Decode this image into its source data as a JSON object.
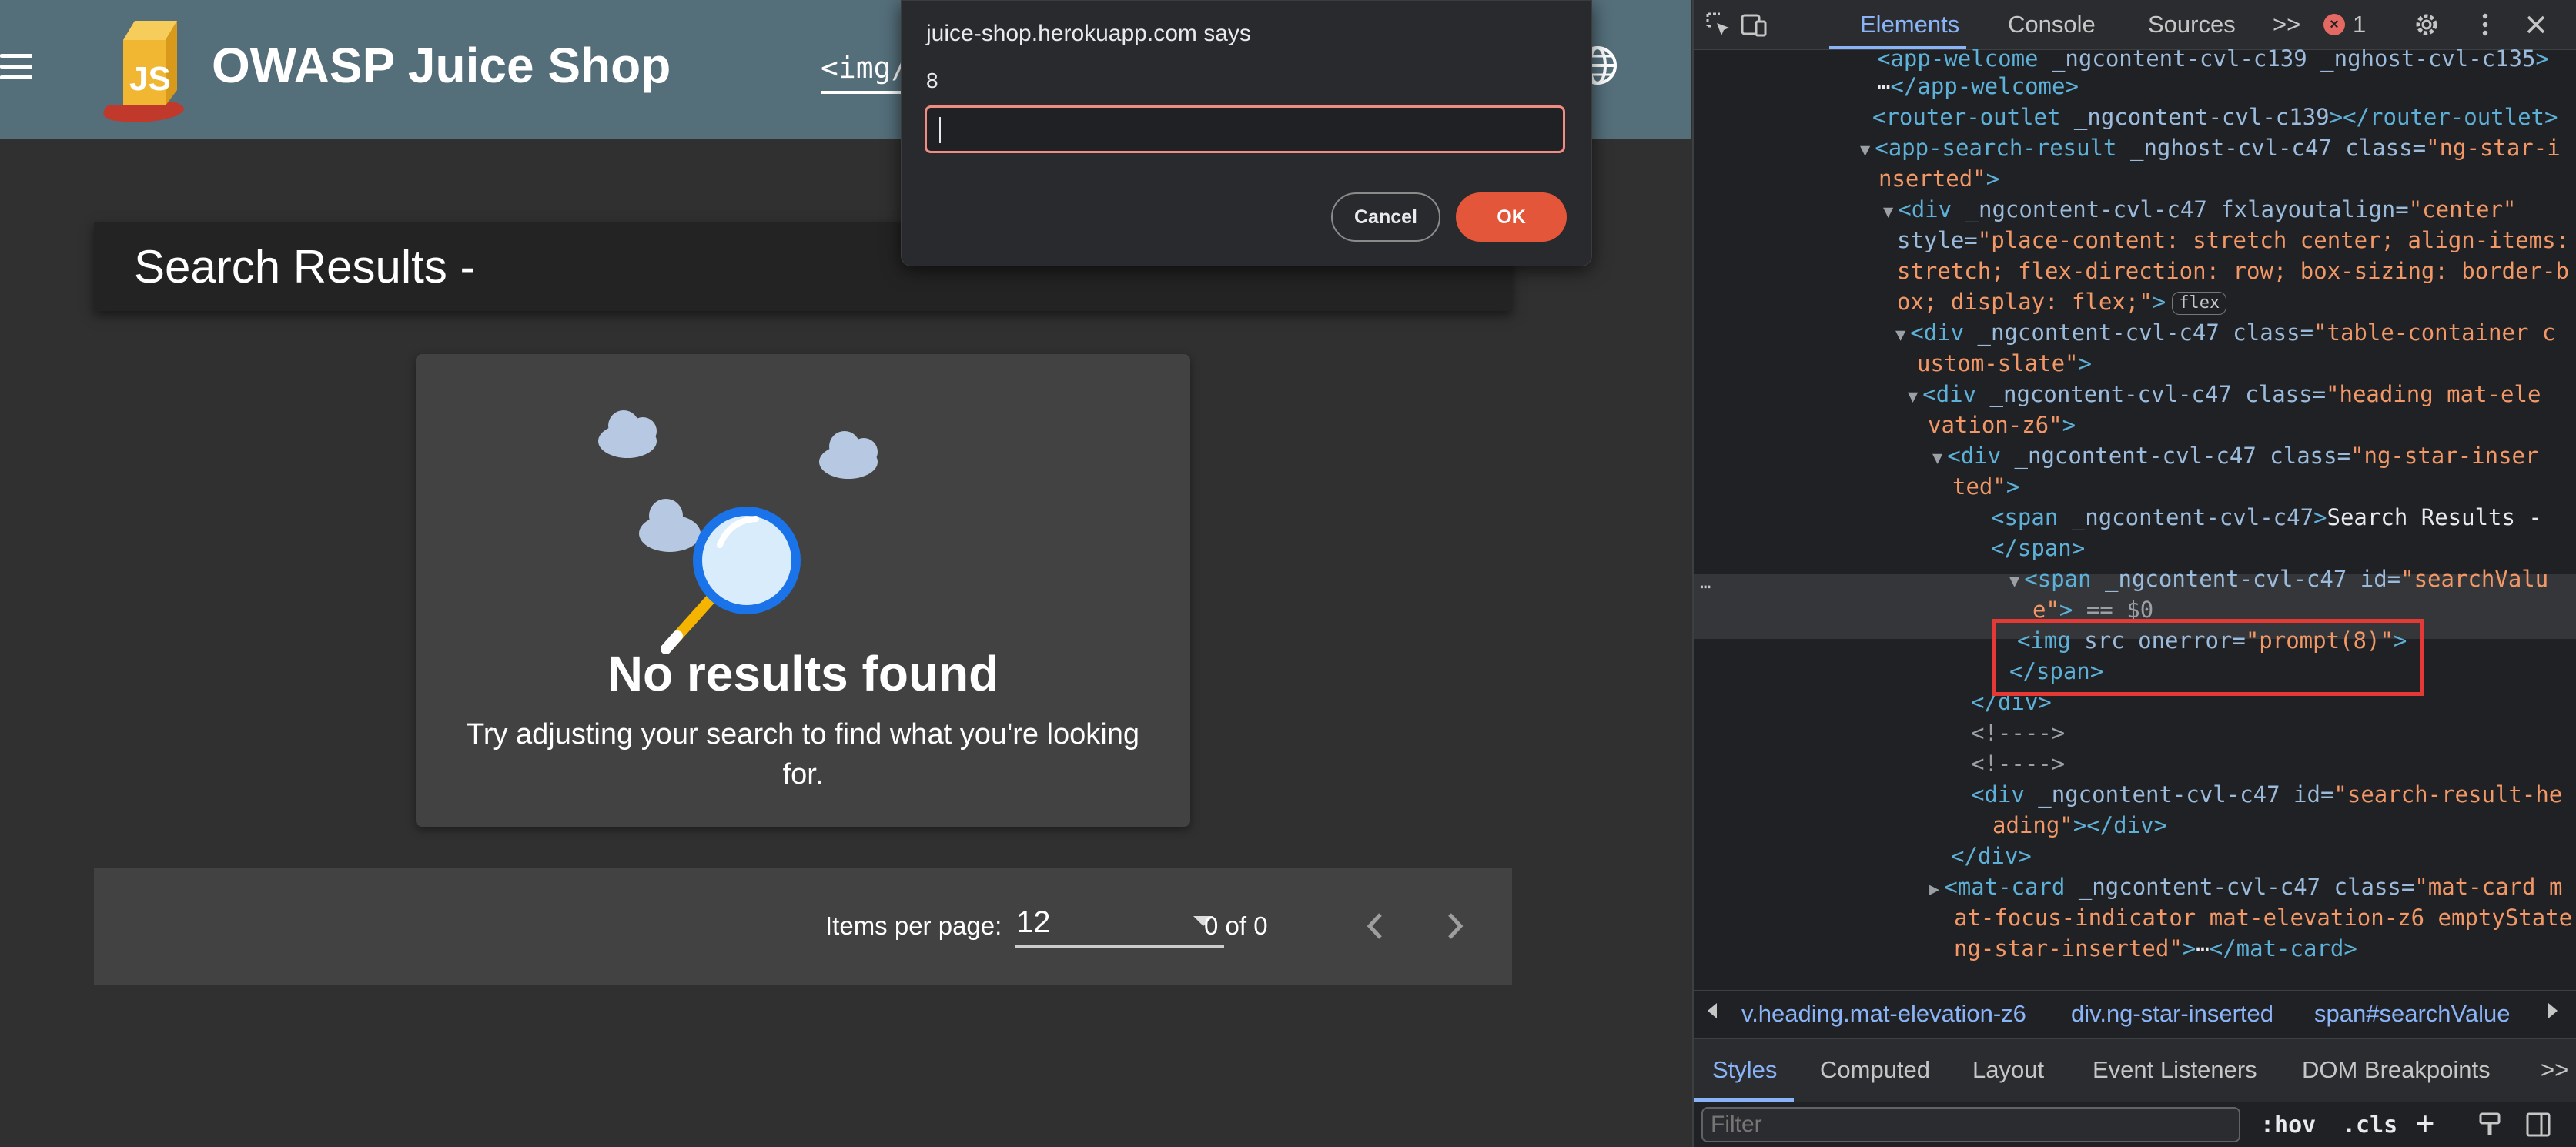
{
  "app": {
    "title": "OWASP Juice Shop",
    "search_value": "<img/s",
    "results_heading": "Search Results -",
    "empty_state": {
      "title": "No results found",
      "text": "Try adjusting your search to find what you're looking for."
    },
    "paginator": {
      "items_per_page_label": "Items per page:",
      "page_size": "12",
      "range": "0 of 0"
    }
  },
  "dialog": {
    "title": "juice-shop.herokuapp.com says",
    "message": "8",
    "input_value": "",
    "cancel_label": "Cancel",
    "ok_label": "OK"
  },
  "devtools": {
    "tabs": [
      "Elements",
      "Console",
      "Sources",
      ">>"
    ],
    "error_count": "1",
    "dom_lines": [
      {
        "parts": [
          [
            "tag",
            "<app-welcome"
          ],
          [
            "attr",
            " _ngcontent-cvl-c139 _nghost-cvl-c135"
          ],
          [
            "tag",
            ">"
          ]
        ]
      },
      {
        "parts": [
          [
            "txt",
            "⋯"
          ],
          [
            "tag",
            "</app-welcome>"
          ]
        ]
      },
      {
        "parts": [
          [
            "tag",
            "<router-outlet"
          ],
          [
            "attr",
            " _ngcontent-cvl-c139"
          ],
          [
            "tag",
            "></router-outlet>"
          ]
        ]
      },
      {
        "parts": [
          [
            "arrow",
            "▼"
          ],
          [
            "tag",
            "<app-search-result"
          ],
          [
            "attr",
            " _nghost-cvl-c47 class="
          ],
          [
            "val",
            "\"ng-star-i"
          ]
        ]
      },
      {
        "parts": [
          [
            "val",
            "nserted\""
          ],
          [
            "tag",
            ">"
          ]
        ]
      },
      {
        "parts": [
          [
            "arrow",
            "▼"
          ],
          [
            "tag",
            "<div"
          ],
          [
            "attr",
            " _ngcontent-cvl-c47 fxlayoutalign="
          ],
          [
            "val",
            "\"center\""
          ]
        ]
      },
      {
        "parts": [
          [
            "attr",
            "style="
          ],
          [
            "val",
            "\"place-content: stretch center; align-items:"
          ]
        ]
      },
      {
        "parts": [
          [
            "val",
            "stretch; flex-direction: row; box-sizing: border-b"
          ]
        ]
      },
      {
        "parts": [
          [
            "val",
            "ox; display: flex;\""
          ],
          [
            "tag",
            ">"
          ],
          [
            "pill",
            "flex"
          ]
        ]
      },
      {
        "parts": [
          [
            "arrow",
            "▼"
          ],
          [
            "tag",
            "<div"
          ],
          [
            "attr",
            " _ngcontent-cvl-c47 class="
          ],
          [
            "val",
            "\"table-container c"
          ]
        ]
      },
      {
        "parts": [
          [
            "val",
            "ustom-slate\""
          ],
          [
            "tag",
            ">"
          ]
        ]
      },
      {
        "parts": [
          [
            "arrow",
            "▼"
          ],
          [
            "tag",
            "<div"
          ],
          [
            "attr",
            " _ngcontent-cvl-c47 class="
          ],
          [
            "val",
            "\"heading mat-ele"
          ]
        ]
      },
      {
        "parts": [
          [
            "val",
            "vation-z6\""
          ],
          [
            "tag",
            ">"
          ]
        ]
      },
      {
        "parts": [
          [
            "arrow",
            "▼"
          ],
          [
            "tag",
            "<div"
          ],
          [
            "attr",
            " _ngcontent-cvl-c47 class="
          ],
          [
            "val",
            "\"ng-star-inser"
          ]
        ]
      },
      {
        "parts": [
          [
            "val",
            "ted\""
          ],
          [
            "tag",
            ">"
          ]
        ]
      },
      {
        "parts": [
          [
            "tag",
            "<span"
          ],
          [
            "attr",
            " _ngcontent-cvl-c47"
          ],
          [
            "tag",
            ">"
          ],
          [
            "txt",
            "Search Results -"
          ]
        ]
      },
      {
        "parts": [
          [
            "tag",
            "</span>"
          ]
        ]
      },
      {
        "parts": [
          [
            "arrow",
            "▼"
          ],
          [
            "tag",
            "<span"
          ],
          [
            "attr",
            " _ngcontent-cvl-c47 id="
          ],
          [
            "val",
            "\"searchValu"
          ]
        ]
      },
      {
        "parts": [
          [
            "val",
            "e\""
          ],
          [
            "tag",
            ">"
          ],
          [
            "cmt",
            " == $0"
          ]
        ]
      },
      {
        "parts": [
          [
            "tag",
            "<img"
          ],
          [
            "attr",
            " src onerror="
          ],
          [
            "val",
            "\"prompt(8)\""
          ],
          [
            "tag",
            ">"
          ]
        ]
      },
      {
        "parts": [
          [
            "tag",
            "</span>"
          ]
        ]
      },
      {
        "parts": [
          [
            "tag",
            "</div>"
          ]
        ]
      },
      {
        "parts": [
          [
            "cmt",
            "<!---->"
          ]
        ]
      },
      {
        "parts": [
          [
            "cmt",
            "<!---->"
          ]
        ]
      },
      {
        "parts": [
          [
            "tag",
            "<div"
          ],
          [
            "attr",
            " _ngcontent-cvl-c47 id="
          ],
          [
            "val",
            "\"search-result-he"
          ]
        ]
      },
      {
        "parts": [
          [
            "val",
            "ading\""
          ],
          [
            "tag",
            "></div>"
          ]
        ]
      },
      {
        "parts": [
          [
            "tag",
            "</div>"
          ]
        ]
      },
      {
        "parts": [
          [
            "arrow",
            "▶"
          ],
          [
            "tag",
            "<mat-card"
          ],
          [
            "attr",
            " _ngcontent-cvl-c47 class="
          ],
          [
            "val",
            "\"mat-card m"
          ]
        ]
      },
      {
        "parts": [
          [
            "val",
            "at-focus-indicator mat-elevation-z6 emptyState"
          ]
        ]
      },
      {
        "parts": [
          [
            "val",
            " ng-star-inserted\""
          ],
          [
            "tag",
            ">"
          ],
          [
            "txt",
            "⋯"
          ],
          [
            "tag",
            "</mat-card>"
          ]
        ]
      }
    ],
    "breadcrumbs": [
      "v.heading.mat-elevation-z6",
      "div.ng-star-inserted",
      "span#searchValue"
    ],
    "subtabs": [
      "Styles",
      "Computed",
      "Layout",
      "Event Listeners",
      "DOM Breakpoints",
      ">>"
    ],
    "filter_placeholder": "Filter",
    "filter_options": [
      ":hov",
      ".cls"
    ]
  },
  "colors": {
    "toolbar": "#546e7a",
    "ok_button": "#e4563a",
    "devtools_accent": "#8ab4f8",
    "highlight_box": "#e53935"
  },
  "icons": [
    "menu-icon",
    "juice-shop-logo",
    "globe-icon",
    "inspect-icon",
    "device-toggle-icon",
    "gear-icon",
    "more-icon",
    "close-icon",
    "chevron-left-icon",
    "chevron-right-icon",
    "caret-down-icon"
  ]
}
